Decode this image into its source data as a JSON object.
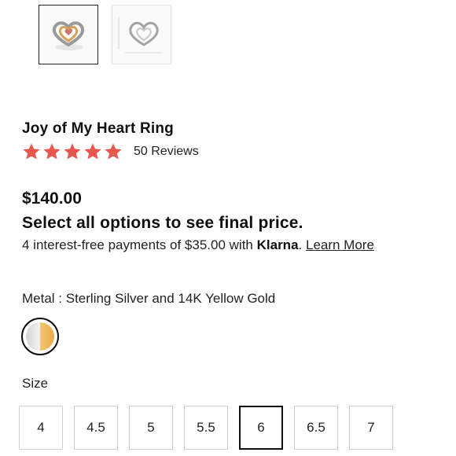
{
  "gallery": {
    "thumbnails": [
      {
        "alt": "ring-front-view",
        "selected": true
      },
      {
        "alt": "ring-dimensions-view",
        "selected": false
      }
    ]
  },
  "product": {
    "title": "Joy of My Heart Ring",
    "rating": {
      "stars": 5,
      "max": 5,
      "reviews_label": "50 Reviews",
      "star_color": "#e8574d"
    },
    "price": "$140.00",
    "price_note": "Select all options to see final price.",
    "klarna": {
      "prefix": "4 interest-free payments of $35.00 with ",
      "brand": "Klarna",
      "separator": ". ",
      "link": "Learn More"
    }
  },
  "options": {
    "metal": {
      "label": "Metal : Sterling Silver and 14K Yellow Gold",
      "swatch_colors": [
        "#e6e6e6",
        "#f0b65c"
      ]
    },
    "size": {
      "label": "Size",
      "values": [
        "4",
        "4.5",
        "5",
        "5.5",
        "6",
        "6.5",
        "7"
      ],
      "selected": "6"
    }
  }
}
